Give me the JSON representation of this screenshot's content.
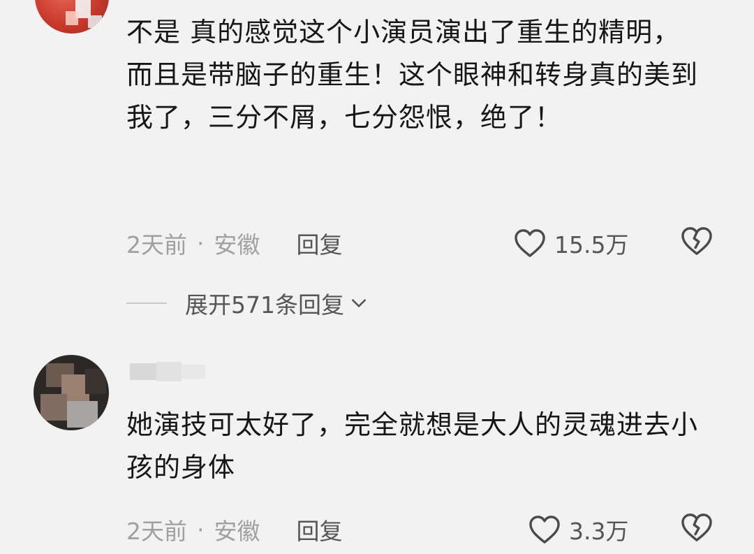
{
  "comments": [
    {
      "text": "不是 真的感觉这个小演员演出了重生的精明，而且是带脑子的重生！这个眼神和转身真的美到我了，三分不屑，七分怨恨，绝了！",
      "time": "2天前",
      "separator": "·",
      "location": "安徽",
      "reply_label": "回复",
      "likes": "15.5万",
      "expand_label": "展开571条回复"
    },
    {
      "text": "她演技可太好了，完全就想是大人的灵魂进去小孩的身体",
      "time": "2天前",
      "separator": "·",
      "location": "安徽",
      "reply_label": "回复",
      "likes": "3.3万"
    }
  ],
  "icons": {
    "like": "heart-outline-icon",
    "dislike": "broken-heart-icon",
    "expand": "chevron-down-icon"
  },
  "colors": {
    "background": "#f2f2f2",
    "text": "#161616",
    "meta": "#a0a0a0",
    "action": "#555555"
  }
}
